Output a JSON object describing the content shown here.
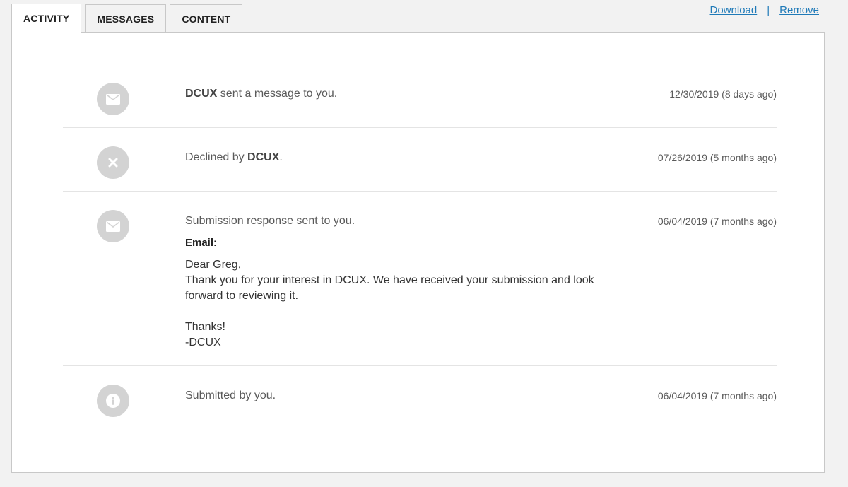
{
  "tabs": [
    {
      "label": "ACTIVITY",
      "active": true
    },
    {
      "label": "MESSAGES",
      "active": false
    },
    {
      "label": "CONTENT",
      "active": false
    }
  ],
  "actions": {
    "download": "Download",
    "separator": "|",
    "remove": "Remove"
  },
  "activity": [
    {
      "icon": "envelope-icon",
      "title_pre": "",
      "title_bold": "DCUX",
      "title_post": " sent a message to you.",
      "date": "12/30/2019 (8 days ago)"
    },
    {
      "icon": "close-icon",
      "title_pre": "Declined by ",
      "title_bold": "DCUX",
      "title_post": ".",
      "date": "07/26/2019 (5 months ago)"
    },
    {
      "icon": "envelope-icon",
      "title_pre": "Submission response sent to you.",
      "title_bold": "",
      "title_post": "",
      "date": "06/04/2019 (7 months ago)",
      "email": {
        "label": "Email:",
        "greeting": "Dear Greg,",
        "body": "Thank you for your interest in DCUX. We have received your submission and look forward to reviewing it.",
        "closing": "Thanks!",
        "signature": "-DCUX"
      }
    },
    {
      "icon": "info-icon",
      "title_pre": "Submitted by you.",
      "title_bold": "",
      "title_post": "",
      "date": "06/04/2019 (7 months ago)"
    }
  ],
  "colors": {
    "link": "#1f7ab8",
    "icon_bg": "#d3d3d3",
    "icon_fg": "#ffffff"
  }
}
